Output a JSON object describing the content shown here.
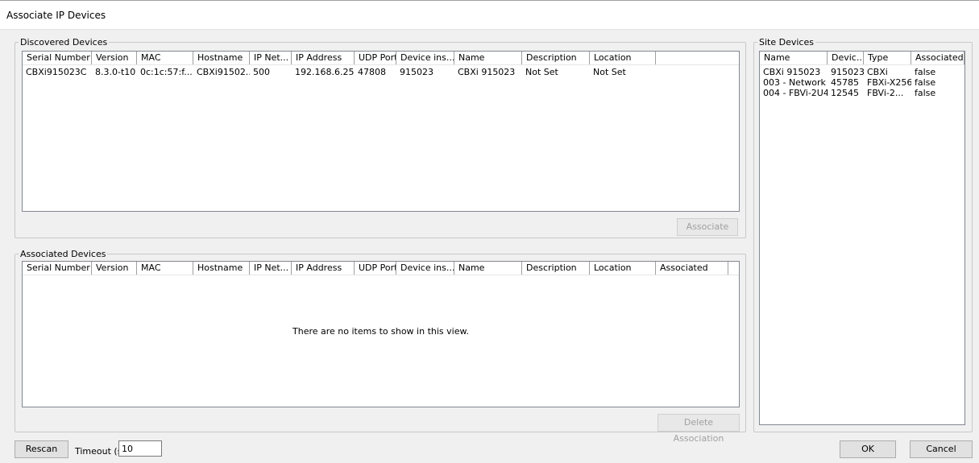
{
  "window": {
    "title": "Associate IP Devices"
  },
  "discovered": {
    "legend": "Discovered Devices",
    "columns": [
      "Serial Number",
      "Version",
      "MAC",
      "Hostname",
      "IP Net...",
      "IP Address",
      "UDP Port",
      "Device ins...",
      "Name",
      "Description",
      "Location"
    ],
    "rows": [
      [
        "CBXi915023C",
        "8.3.0-t10",
        "0c:1c:57:f...",
        "CBXi91502...",
        "500",
        "192.168.6.25",
        "47808",
        "915023",
        "CBXi 915023",
        "Not Set",
        "Not Set"
      ]
    ],
    "button_label": "Associate"
  },
  "associated": {
    "legend": "Associated Devices",
    "columns": [
      "Serial Number",
      "Version",
      "MAC",
      "Hostname",
      "IP Net...",
      "IP Address",
      "UDP Port",
      "Device ins...",
      "Name",
      "Description",
      "Location",
      "Associated"
    ],
    "empty_message": "There are no items to show in this view.",
    "button_label": "Delete Association"
  },
  "site": {
    "legend": "Site Devices",
    "columns": [
      "Name",
      "Devic...",
      "Type",
      "Associated"
    ],
    "rows": [
      [
        "CBXi 915023",
        "915023",
        "CBXi",
        "false"
      ],
      [
        "003 - Network",
        "45785",
        "FBXi-X256",
        "false"
      ],
      [
        "004 - FBVi-2U4...",
        "12545",
        "FBVi-2...",
        "false"
      ]
    ]
  },
  "footer": {
    "rescan_label": "Rescan",
    "timeout_label": "Timeout (s)",
    "timeout_value": "10",
    "ok_label": "OK",
    "cancel_label": "Cancel"
  }
}
